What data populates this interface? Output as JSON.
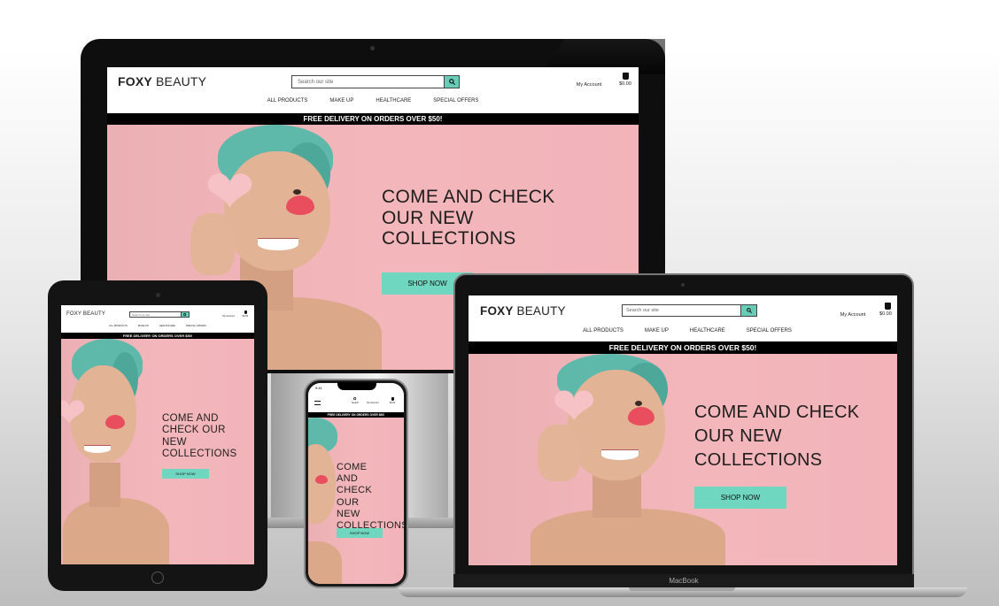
{
  "site": {
    "brand_bold": "FOXY",
    "brand_rest": " BEAUTY",
    "search_placeholder": "Search our site",
    "account_label": "My Account",
    "cart_total": "$0.00",
    "nav": [
      "ALL PRODUCTS",
      "MAKE UP",
      "HEALTHCARE",
      "SPECIAL OFFERS"
    ],
    "banner": "FREE DELIVERY ON ORDERS OVER $50!",
    "hero_title": "COME AND CHECK OUR NEW COLLECTIONS",
    "shop_now": "SHOP NOW"
  },
  "phone": {
    "time": "9:41",
    "search_label": "Search",
    "account_label": "My Account",
    "cart_total": "$0.00"
  },
  "laptop": {
    "model_label": "MacBook"
  },
  "colors": {
    "accent": "#6fd6bf",
    "hero_pink": "#f3b6bb",
    "banner": "#000000"
  },
  "icons": [
    "search-icon",
    "user-icon",
    "shopping-bag-icon",
    "hamburger-menu-icon"
  ]
}
